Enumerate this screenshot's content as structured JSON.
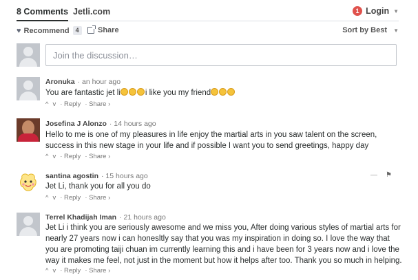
{
  "header": {
    "comments_tab": "8 Comments",
    "site_tab": "Jetli.com",
    "login_badge": "1",
    "login_label": "Login"
  },
  "toolbar": {
    "recommend_label": "Recommend",
    "recommend_count": "4",
    "share_label": "Share",
    "sort_label": "Sort by Best"
  },
  "reply_box": {
    "placeholder": "Join the discussion…"
  },
  "comments": [
    {
      "author": "Aronuka",
      "time": "· an hour ago",
      "text_a": "You are fantastic jet li",
      "text_b": "i like you my friend",
      "upvote": "^",
      "downvote": "v",
      "reply": "· Reply",
      "share": "· Share ›"
    },
    {
      "author": "Josefina J Alonzo",
      "time": "· 14 hours ago",
      "text": "Hello to me is one of my pleasures in life enjoy the martial arts in you saw talent on the screen, success in this new stage in your life and if possible I want you to send greetings, happy day",
      "upvote": "^",
      "downvote": "v",
      "reply": "· Reply",
      "share": "· Share ›"
    },
    {
      "author": "santina agostin",
      "time": "· 15 hours ago",
      "text": "Jet Li, thank you for all you do",
      "upvote": "^",
      "downvote": "v",
      "reply": "· Reply",
      "share": "· Share ›"
    },
    {
      "author": "Terrel Khadijah Iman",
      "time": "· 21 hours ago",
      "text": "Jet Li i think you are seriously awesome and we miss you, After doing various styles of martial arts for nearly 27 years now i can honesltly say that you was my inspiration in doing so. I love the way that you are promoting taiji chuan im currently learning this and i have been for 3 years now and i love the way it makes me feel, not just in the moment but how it helps after too. Thank you so much in helping.",
      "upvote": "^",
      "downvote": "v",
      "reply": "· Reply",
      "share": "· Share ›"
    }
  ]
}
